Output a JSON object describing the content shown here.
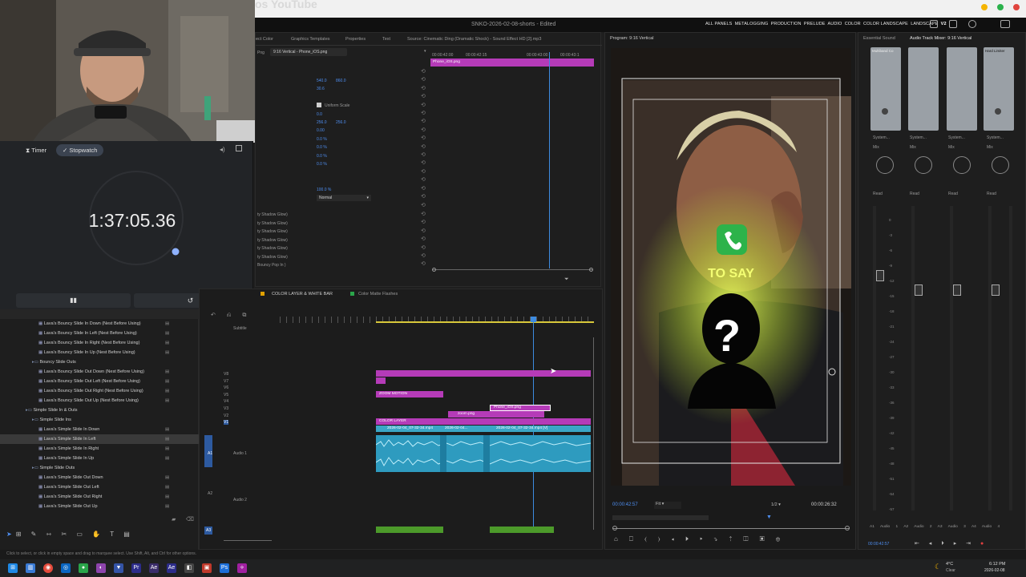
{
  "top_strip": {
    "title_fragment": "os YouTube"
  },
  "title_bar": {
    "project_title": "SNKO-2026-02-08-shorts - Edited",
    "workspaces": [
      "ALL PANELS",
      "METALOGGING",
      "PRODUCTION",
      "PRELUDE",
      "AUDIO",
      "COLOR",
      "COLOR LANDSCAPE",
      "LANDSCAPE",
      "V2"
    ]
  },
  "stopwatch": {
    "tabs": [
      "Timer",
      "Stopwatch"
    ],
    "active_tab": "Stopwatch",
    "time": "1:37:05.36",
    "pause_icon": "pause-icon",
    "reset_icon": "reset-icon"
  },
  "effect_controls": {
    "tabs": [
      "ect Color",
      "Graphics Templates",
      "Properties",
      "Text",
      "Source: Cinematic Ding (Dramatic Shock) - Sound Effect HD [2].mp3"
    ],
    "breadcrumb_left": "Png",
    "breadcrumb_seq": "9:16 Vertical - Phone_iOS.png",
    "ruler_ticks": [
      "00:00:42:00",
      "00:00:42:15",
      "00:00:43:00",
      "00:00:43:1"
    ],
    "clip_name": "Phone_iOS.png",
    "position_values": [
      "540.0",
      "860.0"
    ],
    "scale_value": "30.6",
    "uniform_scale_label": "Uniform Scale",
    "rotation_value": "0.0",
    "anchor_values": [
      "256.0",
      "256.0"
    ],
    "flicker_value": "0.00",
    "crop_values": [
      "0.0 %",
      "0.0 %",
      "0.0 %",
      "0.0 %"
    ],
    "opacity_value": "100.0 %",
    "blend_mode": "Normal",
    "effects": [
      "ty Shadow Glow)",
      "ty Shadow Glow)",
      "ty Shadow Glow)",
      "ty Shadow Glow)",
      "ty Shadow Glow)",
      "ty Shadow Glow)",
      "Bouncy Pop In )"
    ]
  },
  "program_monitor": {
    "title": "Program: 9:16 Vertical",
    "caption": "TO SAY",
    "question": "?",
    "timecode_current": "00:00:42:57",
    "fit": "Fit",
    "resolution": "1/2",
    "timecode_duration": "00:00:26:32"
  },
  "audio_mixer": {
    "tabs": [
      "Essential Sound",
      "Audio Track Mixer: 9:16 Vertical"
    ],
    "plugin_labels": [
      "Multiband Co",
      "Hard Limiter"
    ],
    "channel_output": [
      "System...",
      "System...",
      "System...",
      "System..."
    ],
    "channel_mode": [
      "Mix",
      "Mix",
      "Mix",
      "Mix"
    ],
    "channel_auto": [
      "Read",
      "Read",
      "Read",
      "Read"
    ],
    "meter_scale": [
      "0",
      "-3",
      "-6",
      "-9",
      "-12",
      "-15",
      "-18",
      "-21",
      "-24",
      "-27",
      "-30",
      "-33",
      "-36",
      "-39",
      "-42",
      "-45",
      "-48",
      "-51",
      "-54",
      "-57"
    ],
    "channel_names": [
      "A1",
      "Audio 1",
      "A2",
      "Audio 2",
      "A3",
      "Audio 3",
      "A4",
      "Audio 4"
    ],
    "timecode": "00:00:42:57"
  },
  "project_panel": {
    "items": [
      {
        "label": "Lava's Bouncy Slide In Down (Nest Before Using)",
        "type": "item"
      },
      {
        "label": "Lava's Bouncy Slide In Left (Nest Before Using)",
        "type": "item"
      },
      {
        "label": "Lava's Bouncy Slide In Right (Nest Before Using)",
        "type": "item"
      },
      {
        "label": "Lava's Bouncy Slide In Up (Nest Before Using)",
        "type": "item"
      },
      {
        "label": "Bouncy Slide Outs",
        "type": "folder"
      },
      {
        "label": "Lava's Bouncy Slide Out Down (Nest Before Using)",
        "type": "item"
      },
      {
        "label": "Lava's Bouncy Slide Out Left (Nest Before Using)",
        "type": "item"
      },
      {
        "label": "Lava's Bouncy Slide Out Right (Nest Before Using)",
        "type": "item"
      },
      {
        "label": "Lava's Bouncy Slide Out Up (Nest Before Using)",
        "type": "item"
      },
      {
        "label": "Simple Slide In & Outs",
        "type": "folder0"
      },
      {
        "label": "Simple Slide Ins",
        "type": "folder"
      },
      {
        "label": "Lava's Simple Slide In Down",
        "type": "item"
      },
      {
        "label": "Lava's Simple Slide In Left",
        "type": "item-selected"
      },
      {
        "label": "Lava's Simple Slide In Right",
        "type": "item"
      },
      {
        "label": "Lava's Simple Slide In Up",
        "type": "item"
      },
      {
        "label": "Simple Slide Outs",
        "type": "folder"
      },
      {
        "label": "Lava's Simple Slide Out Down",
        "type": "item"
      },
      {
        "label": "Lava's Simple Slide Out Left",
        "type": "item"
      },
      {
        "label": "Lava's Simple Slide Out Right",
        "type": "item"
      },
      {
        "label": "Lava's Simple Slide Out Up",
        "type": "item"
      }
    ]
  },
  "timeline": {
    "tabs": [
      "COLOR LAYER & WHITE BAR",
      "Color Matte Flashes"
    ],
    "subtitle_track": "Subtitle",
    "video_tracks": [
      "V8",
      "V7",
      "V6",
      "V5",
      "V4",
      "V3",
      "V2",
      "V1"
    ],
    "audio_tracks": [
      "A1",
      "A2",
      "A3"
    ],
    "audio1_name": "Audio 1",
    "audio2_name": "Audio 2",
    "clips": {
      "zoom_motion": "ZOOM MOTION",
      "phone_png_a": "Phone_iOS.png",
      "phone_png_b": "zoom.png",
      "color_layer": "COLOR LAYER",
      "video_main": "2026-02-04_07-32-34.mp4",
      "video_b": "2026-02-04...",
      "video_c": "2026-02-04_07-32-34.mp4 [V]"
    }
  },
  "status_bar": {
    "text": "Click to select, or click in empty space and drag to marquee select. Use Shift, Alt, and Ctrl for other options."
  },
  "taskbar": {
    "weather": "4°C",
    "weather_sub": "Clear",
    "time": "6:12 PM",
    "date": "2026-02-08"
  }
}
